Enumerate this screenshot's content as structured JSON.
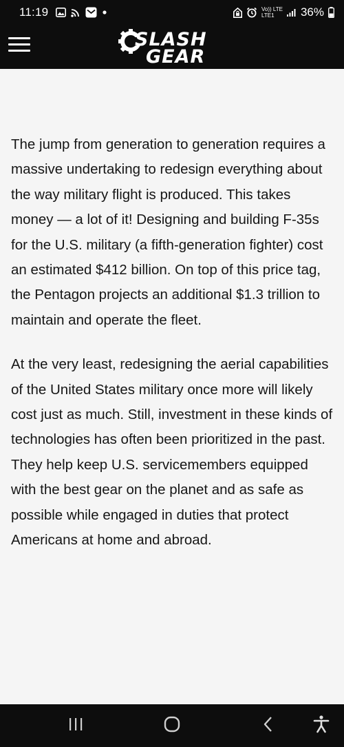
{
  "status_bar": {
    "time": "11:19",
    "network_label": "Vo)) LTE\nLTE1",
    "battery": "36%"
  },
  "header": {
    "logo_line1": "SLASH",
    "logo_line2": "GEAR"
  },
  "article": {
    "paragraphs": [
      "The jump from generation to generation requires a massive undertaking to redesign everything about the way military flight is produced. This takes money — a lot of it! Designing and building F-35s for the U.S. military (a fifth-generation fighter) cost an estimated $412 billion. On top of this price tag, the Pentagon projects an additional $1.3 trillion to maintain and operate the fleet.",
      "At the very least, redesigning the aerial capabilities of the United States military once more will likely cost just as much. Still, investment in these kinds of technologies has often been prioritized in the past. They help keep U.S. servicemembers equipped with the best gear on the planet and as safe as possible while engaged in duties that protect Americans at home and abroad."
    ]
  },
  "icons": {
    "status_left": [
      "gallery-icon",
      "cast-icon",
      "mail-icon",
      "dot-icon"
    ],
    "status_right": [
      "home-lock-icon",
      "alarm-icon",
      "signal-icon",
      "battery-icon"
    ],
    "nav": [
      "recent-apps-icon",
      "home-icon",
      "back-icon",
      "accessibility-icon"
    ]
  }
}
